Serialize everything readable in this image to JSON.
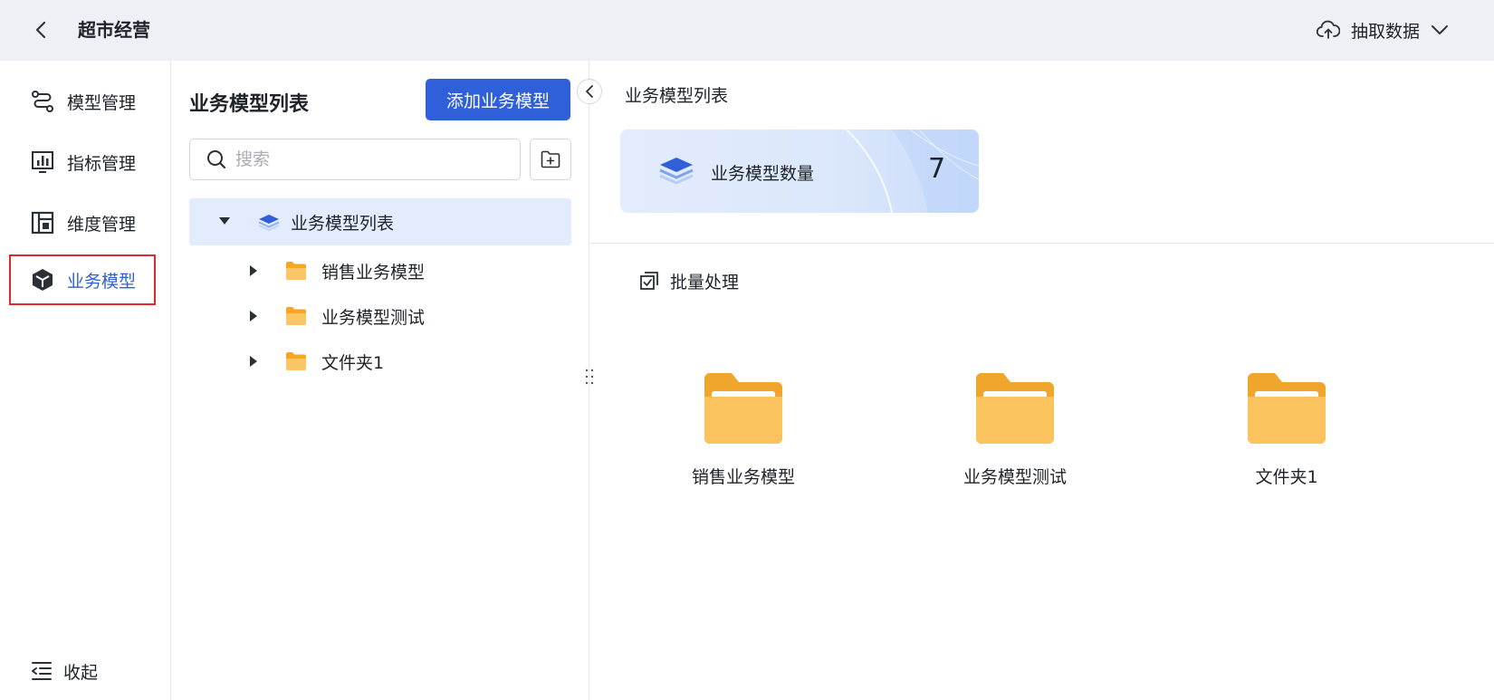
{
  "header": {
    "back_icon": "chevron-left-icon",
    "title": "超市经营",
    "extract_label": "抽取数据",
    "extract_icon": "cloud-upload-icon"
  },
  "nav": {
    "items": [
      {
        "label": "模型管理",
        "icon": "route-icon"
      },
      {
        "label": "指标管理",
        "icon": "bar-chart-icon"
      },
      {
        "label": "维度管理",
        "icon": "dimension-icon"
      },
      {
        "label": "业务模型",
        "icon": "cube-icon"
      }
    ],
    "active_index": 3,
    "collapse_label": "收起"
  },
  "panel": {
    "title": "业务模型列表",
    "add_button": "添加业务模型",
    "search_placeholder": "搜索",
    "tree": {
      "root_label": "业务模型列表",
      "children": [
        "销售业务模型",
        "业务模型测试",
        "文件夹1"
      ]
    }
  },
  "main": {
    "breadcrumb": "业务模型列表",
    "stat": {
      "label": "业务模型数量",
      "value": "7"
    },
    "batch_label": "批量处理",
    "folders": [
      "销售业务模型",
      "业务模型测试",
      "文件夹1"
    ]
  },
  "colors": {
    "accent": "#2f5fd9",
    "header_bg": "#edf0f5",
    "tree_selected_bg": "#e3ecfc",
    "highlight_border": "#e02b2b",
    "folder": "#f5b03c"
  }
}
